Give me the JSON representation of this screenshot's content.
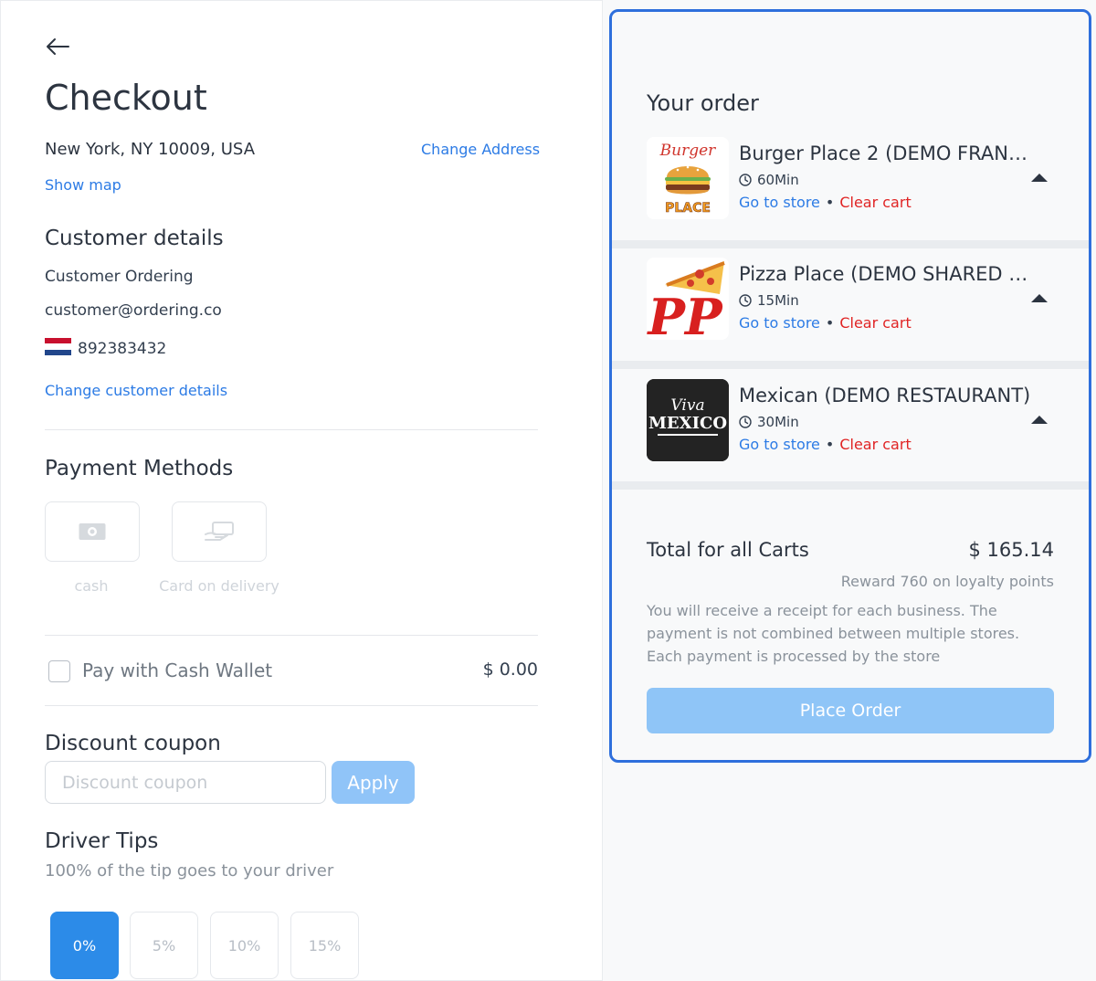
{
  "page": {
    "title": "Checkout"
  },
  "address": {
    "text": "New York, NY 10009, USA",
    "change_label": "Change Address",
    "show_map_label": "Show map"
  },
  "customer": {
    "heading": "Customer details",
    "name": "Customer Ordering",
    "email": "customer@ordering.co",
    "phone": "892383432",
    "flag_icon": "netherlands-flag-icon",
    "change_label": "Change customer details"
  },
  "payment": {
    "heading": "Payment Methods",
    "methods": [
      {
        "label": "cash",
        "icon": "cash-icon"
      },
      {
        "label": "Card on delivery",
        "icon": "card-hand-icon"
      }
    ]
  },
  "wallet": {
    "label": "Pay with Cash Wallet",
    "amount": "$ 0.00"
  },
  "coupon": {
    "heading": "Discount coupon",
    "placeholder": "Discount coupon",
    "apply_label": "Apply"
  },
  "tips": {
    "heading": "Driver Tips",
    "subtitle": "100% of the tip goes to your driver",
    "options": [
      "0%",
      "5%",
      "10%",
      "15%"
    ],
    "selected": "0%"
  },
  "order": {
    "heading": "Your order",
    "stores": [
      {
        "name": "Burger Place 2 (DEMO FRANC...",
        "time": "60Min",
        "go_label": "Go to store",
        "clear_label": "Clear cart",
        "logo_text_top": "Burger",
        "logo_text_bottom": "PLACE"
      },
      {
        "name": "Pizza Place (DEMO SHARED M...",
        "time": "15Min",
        "go_label": "Go to store",
        "clear_label": "Clear cart",
        "logo_text": "PP"
      },
      {
        "name": "Mexican (DEMO RESTAURANT)",
        "time": "30Min",
        "go_label": "Go to store",
        "clear_label": "Clear cart",
        "logo_text_top": "Viva",
        "logo_text_bottom": "MEXICO"
      }
    ],
    "total_label": "Total for all Carts",
    "total_value": "$ 165.14",
    "reward": "Reward 760 on loyalty points",
    "receipt_note": "You will receive a receipt for each business. The payment is not combined between multiple stores. Each payment is processed by the store",
    "place_label": "Place Order"
  },
  "colors": {
    "accent": "#2c7be5",
    "danger": "#e02424",
    "panel_border": "#2e6fdc",
    "disabled_button": "#8fc5f7"
  }
}
